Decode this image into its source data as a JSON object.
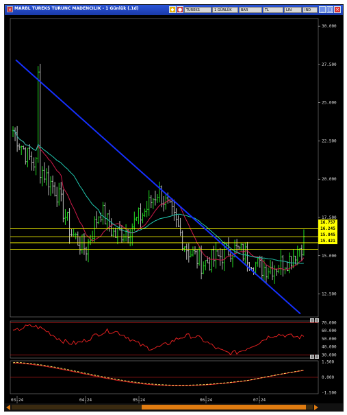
{
  "window": {
    "title": "MARBL TUREKS TURUNC MADENCILIK - 1 Günlük (.1d)",
    "toolbar_fields": [
      "TUREKS",
      "1 GÜNLÜK",
      "BAR",
      "TL",
      "LIN",
      "IND"
    ],
    "accent_color": "#2a55d8"
  },
  "price_axis": [
    "30.000",
    "27.500",
    "25.000",
    "22.500",
    "20.000",
    "17.500",
    "15.000",
    "12.500"
  ],
  "price_flags": [
    "16.757",
    "16.245",
    "15.845",
    "15.421"
  ],
  "rsi_axis": [
    "70.000",
    "60.000",
    "50.000",
    "40.000",
    "30.000"
  ],
  "macd_axis": [
    "1.500",
    "0.000",
    "-1.500"
  ],
  "date_labels": [
    "03-24",
    "04-24",
    "05-24",
    "06-24",
    "07-24"
  ],
  "chart_data": [
    {
      "type": "line",
      "panel": "price",
      "ylim": [
        11,
        30.5
      ],
      "x": [
        "03-24",
        "04-24",
        "05-24",
        "06-24",
        "07-24"
      ],
      "series": [
        {
          "values": [
            23.2,
            21.5,
            20.6,
            19.2,
            16.5,
            15.4,
            18.0,
            16.3,
            16.8,
            17.8,
            19.3,
            17.5,
            15.4,
            14.5,
            14.8,
            15.5,
            15.1,
            14.2,
            14.3,
            14.8,
            15.9
          ]
        }
      ],
      "trendline": {
        "from": 27.8,
        "to": 11.2
      },
      "levels": [
        16.757,
        16.245,
        15.845,
        15.421
      ],
      "grid": false
    },
    {
      "type": "line",
      "panel": "rsi",
      "ylim": [
        26,
        72
      ],
      "levels": [
        70,
        30
      ]
    },
    {
      "type": "line",
      "panel": "macd",
      "ylim": [
        -1.6,
        1.6
      ],
      "levels": [
        0
      ]
    }
  ]
}
